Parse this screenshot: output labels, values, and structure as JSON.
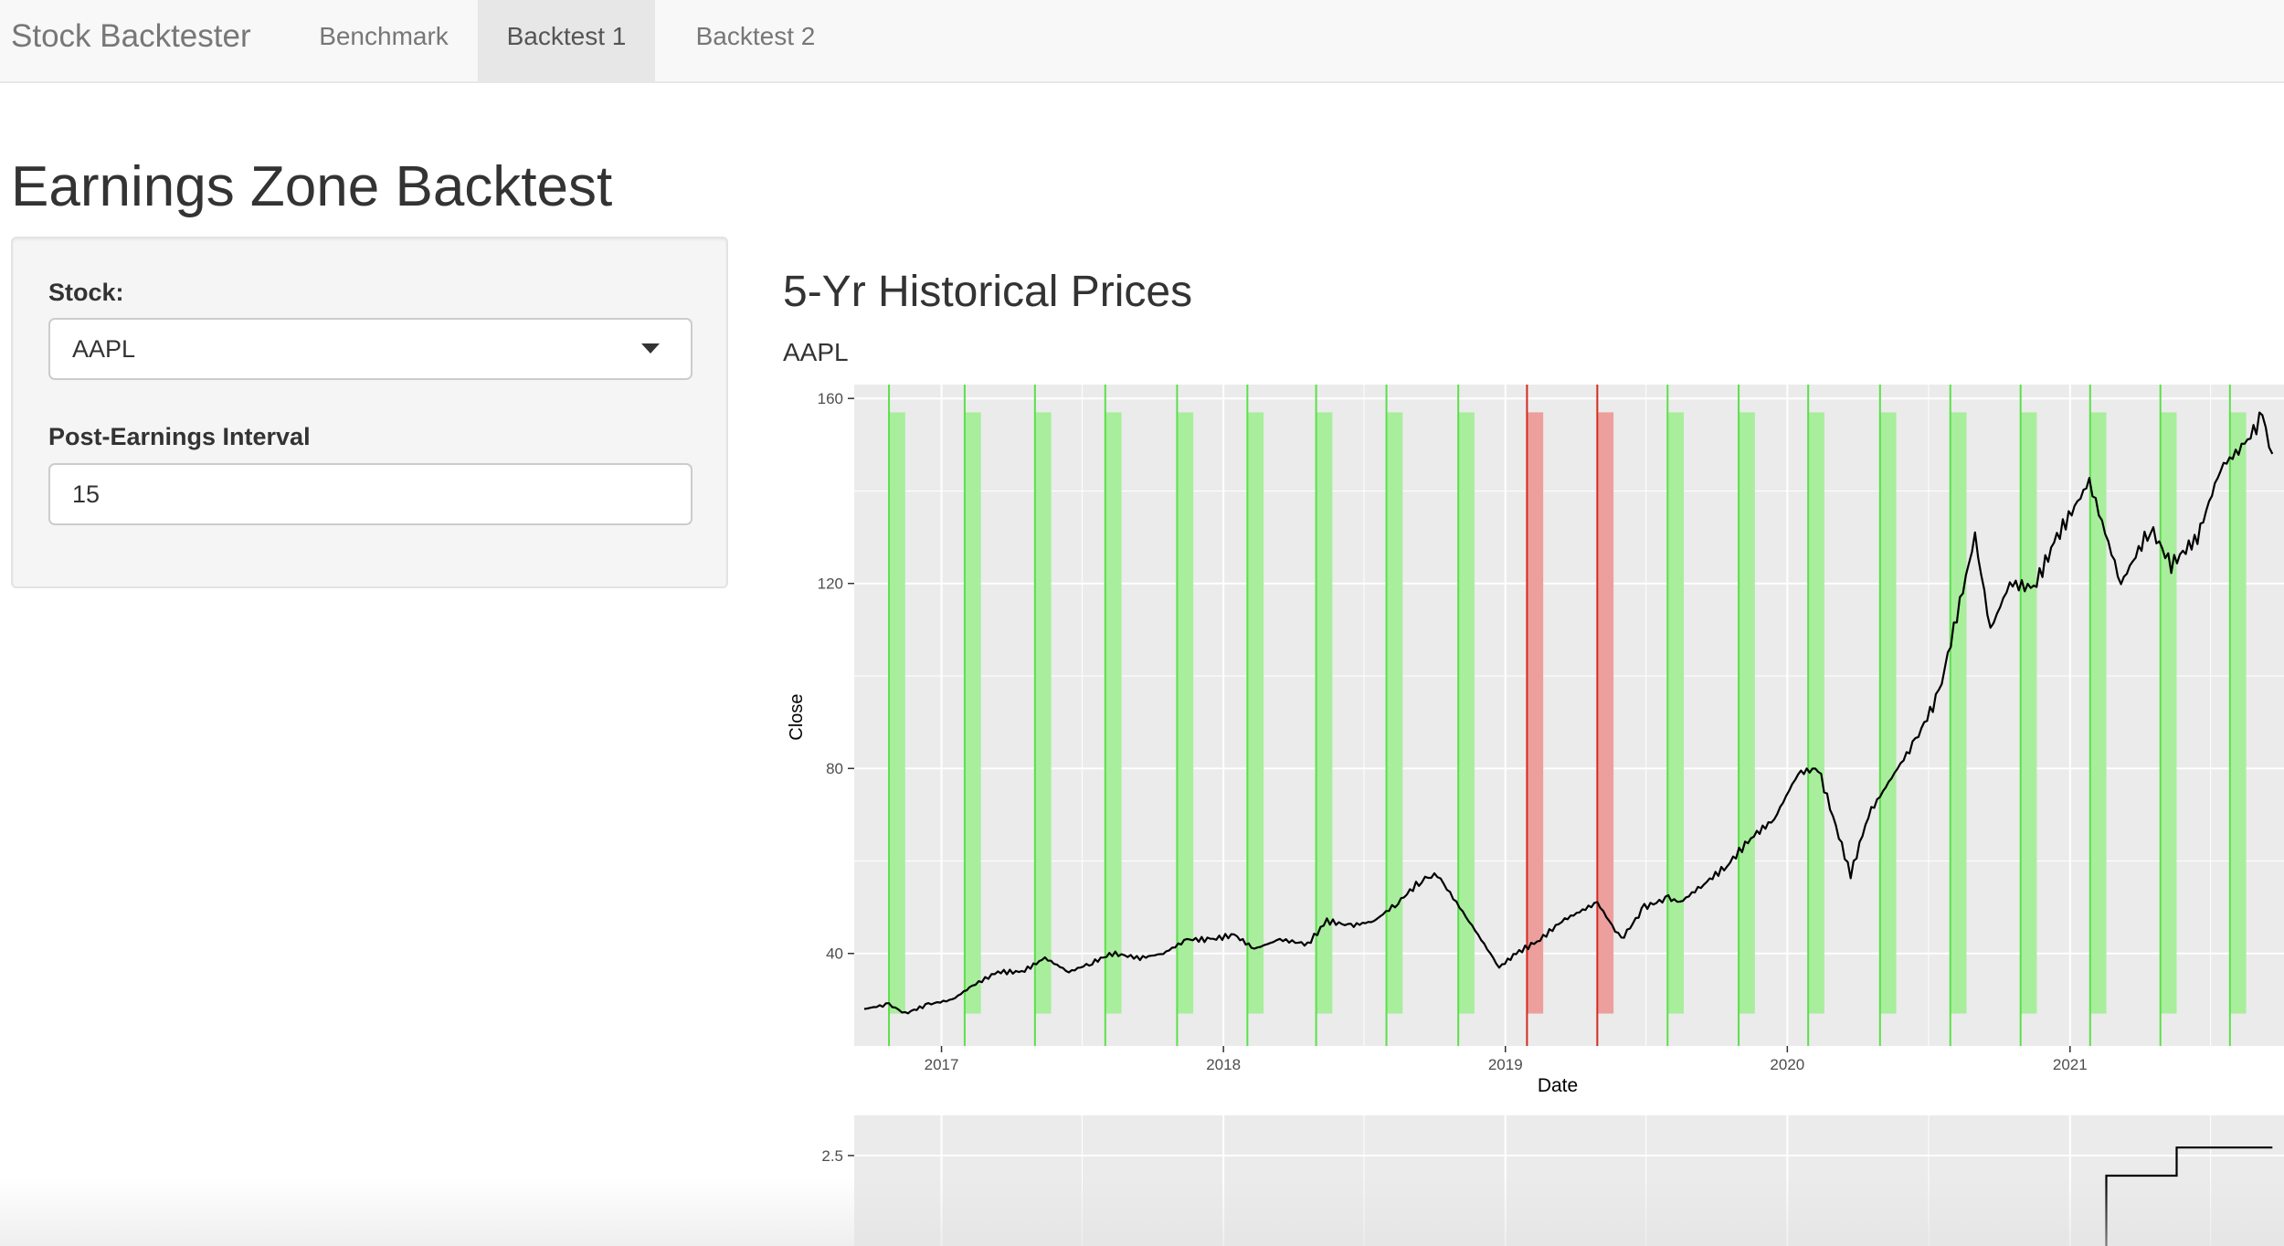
{
  "navbar": {
    "brand": "Stock Backtester",
    "tabs": [
      {
        "label": "Benchmark",
        "active": false
      },
      {
        "label": "Backtest 1",
        "active": true
      },
      {
        "label": "Backtest 2",
        "active": false
      }
    ]
  },
  "page_title": "Earnings Zone Backtest",
  "sidebar": {
    "stock_label": "Stock:",
    "stock_value": "AAPL",
    "interval_label": "Post-Earnings Interval",
    "interval_value": "15"
  },
  "main": {
    "section_title": "5-Yr Historical Prices",
    "chart_subtitle": "AAPL"
  },
  "colors": {
    "gain_zone": "#a8ee9c",
    "gain_line": "#5be04a",
    "loss_zone": "#ec9f9c",
    "loss_line": "#d42a20",
    "panel_bg": "#ebebeb",
    "price_line": "#000000"
  },
  "chart_data": [
    {
      "type": "line",
      "title": "AAPL",
      "xlabel": "Date",
      "ylabel": "Close",
      "grid": true,
      "x_range": [
        "2016-09-10",
        "2021-10-05"
      ],
      "ylim": [
        20,
        163
      ],
      "x_ticks": [
        "2017",
        "2018",
        "2019",
        "2020",
        "2021"
      ],
      "y_ticks": [
        40,
        80,
        120,
        160
      ],
      "series": [
        {
          "x": [
            "2016-09-23",
            "2016-10-25",
            "2016-11-15",
            "2016-12-15",
            "2017-01-15",
            "2017-02-10",
            "2017-03-15",
            "2017-04-15",
            "2017-05-15",
            "2017-06-15",
            "2017-07-15",
            "2017-08-10",
            "2017-09-15",
            "2017-10-15",
            "2017-11-15",
            "2017-12-15",
            "2018-01-15",
            "2018-02-10",
            "2018-03-15",
            "2018-04-20",
            "2018-05-15",
            "2018-06-15",
            "2018-07-15",
            "2018-08-15",
            "2018-09-15",
            "2018-10-05",
            "2018-11-15",
            "2018-12-24",
            "2019-01-15",
            "2019-02-15",
            "2019-03-15",
            "2019-04-30",
            "2019-05-31",
            "2019-06-30",
            "2019-07-31",
            "2019-08-15",
            "2019-09-15",
            "2019-10-15",
            "2019-11-15",
            "2019-12-15",
            "2020-01-15",
            "2020-02-10",
            "2020-03-23",
            "2020-04-15",
            "2020-05-15",
            "2020-06-15",
            "2020-07-15",
            "2020-08-31",
            "2020-09-20",
            "2020-10-15",
            "2020-11-15",
            "2020-12-15",
            "2021-01-26",
            "2021-03-08",
            "2021-04-15",
            "2021-05-12",
            "2021-06-15",
            "2021-07-15",
            "2021-08-15",
            "2021-09-07",
            "2021-09-20"
          ],
          "y": [
            28,
            29,
            27,
            29,
            30,
            33,
            36,
            36,
            39,
            36,
            38,
            40,
            39,
            40,
            43,
            43,
            44,
            41,
            43,
            42,
            47,
            46,
            47,
            51,
            56,
            57,
            47,
            37,
            40,
            43,
            47,
            51,
            43,
            50,
            52,
            51,
            55,
            59,
            65,
            69,
            79,
            80,
            57,
            70,
            78,
            86,
            96,
            130,
            110,
            120,
            119,
            130,
            142,
            120,
            132,
            124,
            130,
            145,
            150,
            156,
            148
          ],
          "line_color": "#000000"
        }
      ],
      "zones": [
        {
          "start": "2016-10-25",
          "end": "2016-11-15",
          "result": "gain"
        },
        {
          "start": "2017-01-31",
          "end": "2017-02-21",
          "result": "gain"
        },
        {
          "start": "2017-05-02",
          "end": "2017-05-23",
          "result": "gain"
        },
        {
          "start": "2017-08-01",
          "end": "2017-08-22",
          "result": "gain"
        },
        {
          "start": "2017-11-02",
          "end": "2017-11-23",
          "result": "gain"
        },
        {
          "start": "2018-02-01",
          "end": "2018-02-22",
          "result": "gain"
        },
        {
          "start": "2018-05-01",
          "end": "2018-05-22",
          "result": "gain"
        },
        {
          "start": "2018-07-31",
          "end": "2018-08-21",
          "result": "gain"
        },
        {
          "start": "2018-11-01",
          "end": "2018-11-22",
          "result": "gain"
        },
        {
          "start": "2019-01-29",
          "end": "2019-02-19",
          "result": "loss"
        },
        {
          "start": "2019-04-30",
          "end": "2019-05-21",
          "result": "loss"
        },
        {
          "start": "2019-07-30",
          "end": "2019-08-20",
          "result": "gain"
        },
        {
          "start": "2019-10-30",
          "end": "2019-11-20",
          "result": "gain"
        },
        {
          "start": "2020-01-28",
          "end": "2020-02-18",
          "result": "gain"
        },
        {
          "start": "2020-04-30",
          "end": "2020-05-21",
          "result": "gain"
        },
        {
          "start": "2020-07-30",
          "end": "2020-08-20",
          "result": "gain"
        },
        {
          "start": "2020-10-29",
          "end": "2020-11-19",
          "result": "gain"
        },
        {
          "start": "2021-01-27",
          "end": "2021-02-17",
          "result": "gain"
        },
        {
          "start": "2021-04-28",
          "end": "2021-05-19",
          "result": "gain"
        },
        {
          "start": "2021-07-27",
          "end": "2021-08-17",
          "result": "gain"
        }
      ],
      "zone_band_ylim": [
        27,
        157
      ]
    },
    {
      "type": "line",
      "subtype": "step",
      "grid": true,
      "y_ticks": [
        2.5
      ],
      "ylim": [
        1.6,
        2.9
      ],
      "x_range": [
        "2016-09-10",
        "2021-10-05"
      ],
      "series": [
        {
          "x": [
            "2021-02-17",
            "2021-05-19",
            "2021-09-20"
          ],
          "y": [
            2.3,
            2.58,
            2.58
          ]
        }
      ]
    }
  ]
}
